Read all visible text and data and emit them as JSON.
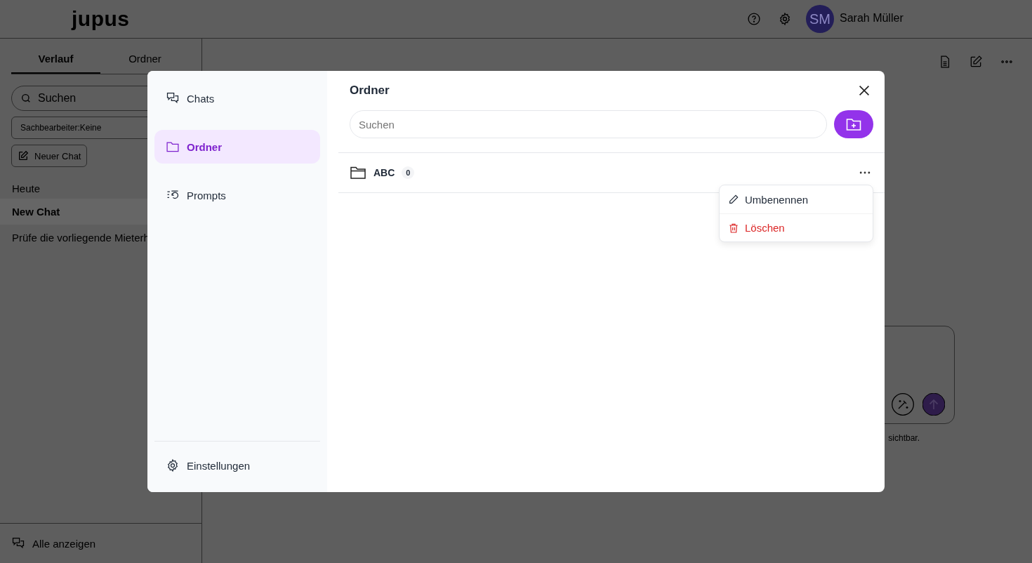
{
  "header": {
    "logo": "jupus",
    "user": {
      "initials": "SM",
      "name": "Sarah Müller"
    }
  },
  "sidebar": {
    "tabs": [
      {
        "label": "Verlauf",
        "selected": true
      },
      {
        "label": "Ordner",
        "selected": false
      }
    ],
    "search": {
      "placeholder": "Suchen"
    },
    "filter": {
      "label": "Sachbearbeiter:",
      "value": "Keine"
    },
    "new_chat": "Neuer Chat",
    "sections": [
      {
        "title": "Heute",
        "items": [
          {
            "title": "New Chat",
            "selected": true
          },
          {
            "title": "Prüfe die vorliegende Mieterh",
            "selected": false
          }
        ]
      }
    ],
    "footer": "Alle anzeigen"
  },
  "composer": {
    "note": "sichtbar."
  },
  "modal": {
    "nav": [
      {
        "label": "Chats",
        "kind": "chats",
        "selected": false
      },
      {
        "label": "Ordner",
        "kind": "folder",
        "selected": true
      },
      {
        "label": "Prompts",
        "kind": "prompts",
        "selected": false
      }
    ],
    "settings": "Einstellungen",
    "title": "Ordner",
    "search": {
      "placeholder": "Suchen"
    },
    "folders": [
      {
        "name": "ABC",
        "count": "0"
      }
    ],
    "menu": [
      {
        "label": "Umbenennen",
        "kind": "edit"
      },
      {
        "label": "Löschen",
        "kind": "delete"
      }
    ]
  }
}
